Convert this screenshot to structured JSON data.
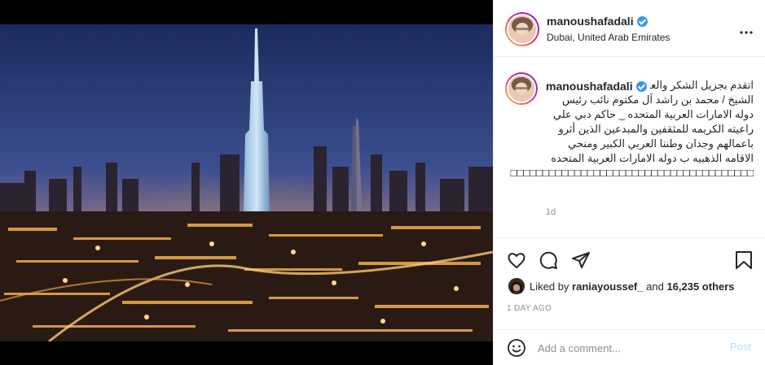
{
  "post": {
    "username": "manoushafadali",
    "location": "Dubai, United Arab Emirates",
    "more_icon": "more-horizontal-icon"
  },
  "caption": {
    "username": "manoushafadali",
    "text": "اتقدم بجزيل الشكر والعرفان الي صاحب السمو الشيخ / محمد بن راشد آل مكتوم نائب رئيس دوله الامارات العربية المتحده _ حاكم دبي علي راعيته الكريمه للمثقفين والمبدعين الذين أثرو باعمالهم وجدان وطننا العربي الكبير ومنحي الاقامه الذهبيه ب دوله الامارات العربية المتحده □□□□□□□□□□□□□□□□□□□□□□□□□□□□□□□□□□□□□□",
    "time": "1d"
  },
  "actions": {
    "like_icon": "heart-icon",
    "comment_icon": "comment-icon",
    "share_icon": "share-icon",
    "save_icon": "bookmark-icon"
  },
  "likes": {
    "prefix": "Liked by",
    "user": "raniayoussef_",
    "middle": "and",
    "count": "16,235 others"
  },
  "posted": "1 DAY AGO",
  "comment": {
    "placeholder": "Add a comment...",
    "post_label": "Post",
    "emoji_icon": "emoji-icon"
  },
  "colors": {
    "verified": "#3897f0",
    "post_disabled": "#b2dffc",
    "muted": "#8e8e8e"
  }
}
